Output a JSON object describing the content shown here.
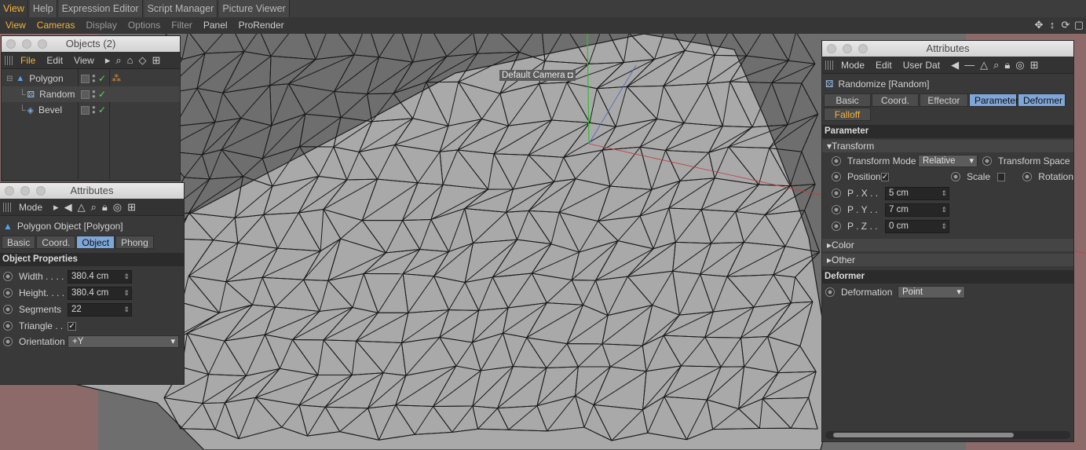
{
  "menubar_top": [
    "View",
    "Help",
    "Expression Editor",
    "Script Manager",
    "Picture Viewer"
  ],
  "menubar_viewport": [
    "View",
    "Cameras",
    "Display",
    "Options",
    "Filter",
    "Panel",
    "ProRender"
  ],
  "viewport": {
    "camera_label": "Default Camera"
  },
  "objects": {
    "title": "Objects (2)",
    "menu": [
      "File",
      "Edit",
      "View"
    ],
    "items": [
      {
        "name": "Polygon"
      },
      {
        "name": "Random"
      },
      {
        "name": "Bevel"
      }
    ]
  },
  "attr_left": {
    "title": "Attributes",
    "mode_label": "Mode",
    "object_label": "Polygon Object [Polygon]",
    "tabs": [
      "Basic",
      "Coord.",
      "Object",
      "Phong"
    ],
    "section": "Object Properties",
    "width_label": "Width . . . .",
    "width_value": "380.4 cm",
    "height_label": "Height. . . .",
    "height_value": "380.4 cm",
    "segments_label": "Segments",
    "segments_value": "22",
    "triangle_label": "Triangle . .",
    "orientation_label": "Orientation",
    "orientation_value": "+Y"
  },
  "attr_right": {
    "title": "Attributes",
    "menu": [
      "Mode",
      "Edit",
      "User Dat"
    ],
    "object_label": "Randomize [Random]",
    "tabs": [
      "Basic",
      "Coord.",
      "Effector",
      "Parameter",
      "Deformer",
      "Falloff"
    ],
    "section_parameter": "Parameter",
    "transform_label": "Transform",
    "transform_mode_label": "Transform Mode",
    "transform_mode_value": "Relative",
    "transform_space_label": "Transform Space",
    "position_label": "Position",
    "scale_label": "Scale",
    "rotation_label": "Rotation",
    "px_label": "P . X . .",
    "px_value": "5 cm",
    "py_label": "P . Y . .",
    "py_value": "7 cm",
    "pz_label": "P . Z . .",
    "pz_value": "0 cm",
    "color_label": "Color",
    "other_label": "Other",
    "section_deformer": "Deformer",
    "deformation_label": "Deformation",
    "deformation_value": "Point"
  }
}
